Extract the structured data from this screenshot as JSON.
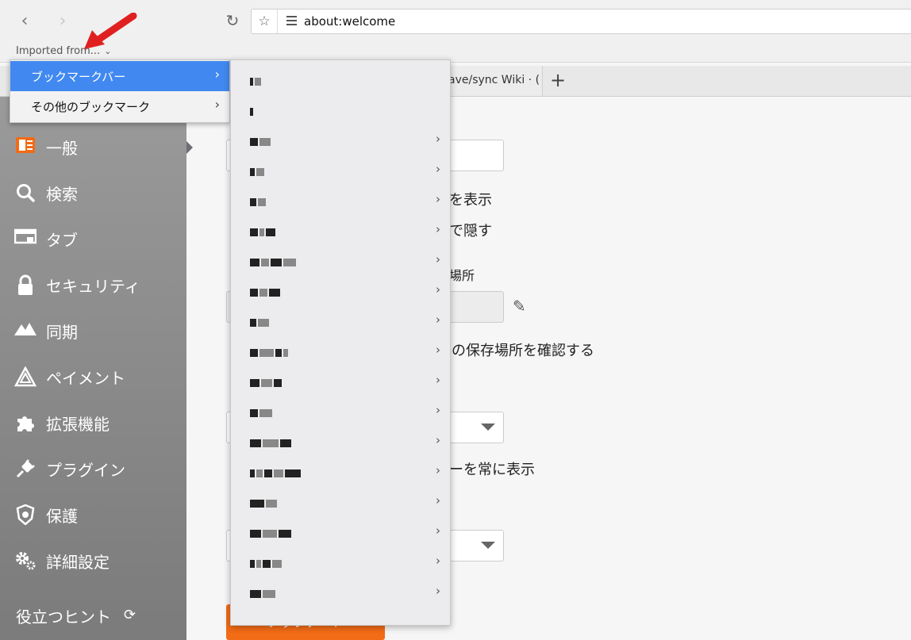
{
  "toolbar": {
    "back_icon": "‹",
    "forward_icon": "›",
    "reload_icon": "↻",
    "star_icon": "☆",
    "url": "about:welcome"
  },
  "bookmarks_bar": {
    "imported_label": "Imported from...",
    "chevron": "⌄"
  },
  "tabs": [
    {
      "label": "ave/sync Wiki · ("
    }
  ],
  "new_tab_icon": "+",
  "sidebar": {
    "items": [
      {
        "label": "一般",
        "icon": "general-icon"
      },
      {
        "label": "検索",
        "icon": "search-icon"
      },
      {
        "label": "タブ",
        "icon": "tab-icon"
      },
      {
        "label": "セキュリティ",
        "icon": "lock-icon"
      },
      {
        "label": "同期",
        "icon": "sync-icon"
      },
      {
        "label": "ペイメント",
        "icon": "payment-icon"
      },
      {
        "label": "拡張機能",
        "icon": "puzzle-icon"
      },
      {
        "label": "プラグイン",
        "icon": "plug-icon"
      },
      {
        "label": "保護",
        "icon": "shield-icon"
      },
      {
        "label": "詳細設定",
        "icon": "gears-icon"
      }
    ],
    "tip_label": "役立つヒント",
    "tip_icon": "refresh-icon"
  },
  "content": {
    "text1": "を表示",
    "text2": "で隠す",
    "text3": "場所",
    "text4": "ルの保存場所を確認する",
    "text5": "ーを常に表示",
    "button_label": "アップデート"
  },
  "menu": {
    "level1": [
      {
        "label": "ブックマークバー",
        "selected": true
      },
      {
        "label": "その他のブックマーク",
        "selected": false
      }
    ],
    "level2_count": 18,
    "level2_has_submenu": [
      false,
      false,
      true,
      true,
      true,
      true,
      true,
      true,
      true,
      true,
      true,
      true,
      true,
      true,
      true,
      true,
      true,
      true
    ]
  },
  "colors": {
    "selection_blue": "#4189f0",
    "accent_orange": "#f26b16",
    "annotation_red": "#e02020"
  }
}
